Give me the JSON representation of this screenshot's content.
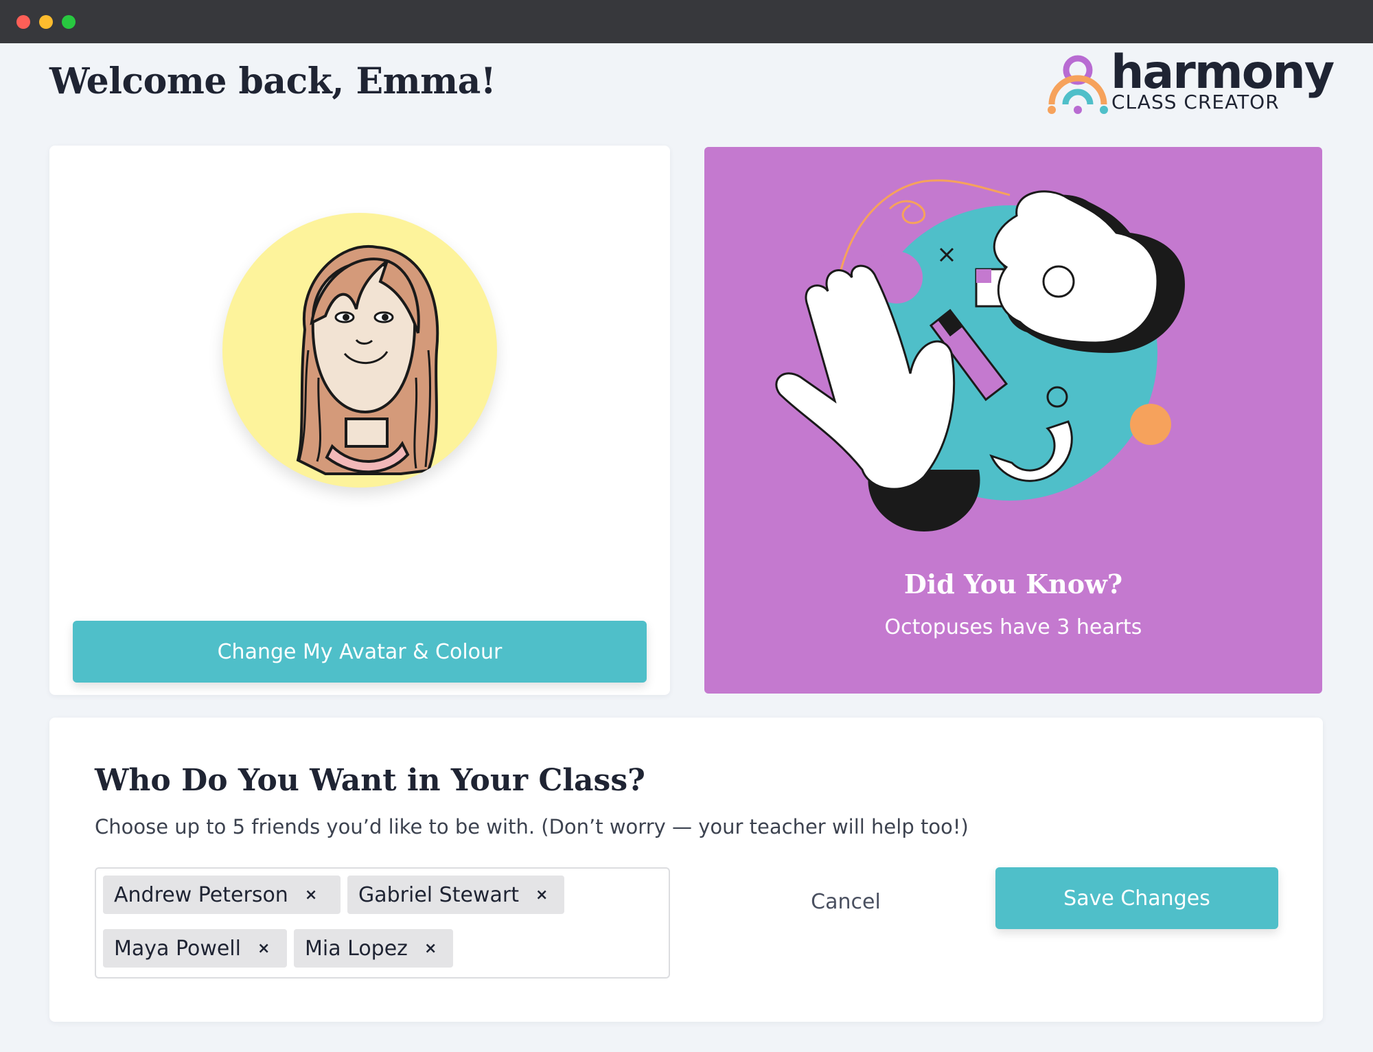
{
  "window": {
    "controls": [
      "close",
      "minimize",
      "maximize"
    ]
  },
  "header": {
    "greeting": "Welcome back, Emma!",
    "logo": {
      "word": "harmony",
      "tagline": "CLASS CREATOR"
    }
  },
  "avatar_card": {
    "avatar_color": "#fdf39b",
    "change_button_label": "Change My Avatar & Colour"
  },
  "fact_card": {
    "background": "#c479cf",
    "title": "Did You Know?",
    "text": "Octopuses have 3 hearts"
  },
  "class_picker": {
    "title": "Who Do You Want in Your Class?",
    "subtitle": "Choose up to 5 friends you’d like to be with. (Don’t worry — your teacher will help too!)",
    "selected_friends": [
      {
        "name": "Andrew Peterson"
      },
      {
        "name": "Gabriel Stewart"
      },
      {
        "name": "Maya Powell"
      },
      {
        "name": "Mia Lopez"
      }
    ],
    "remove_glyph": "×",
    "cancel_label": "Cancel",
    "save_label": "Save Changes"
  },
  "colors": {
    "accent_teal": "#4fbfc9",
    "fact_purple": "#c479cf",
    "page_bg": "#f1f4f8"
  }
}
